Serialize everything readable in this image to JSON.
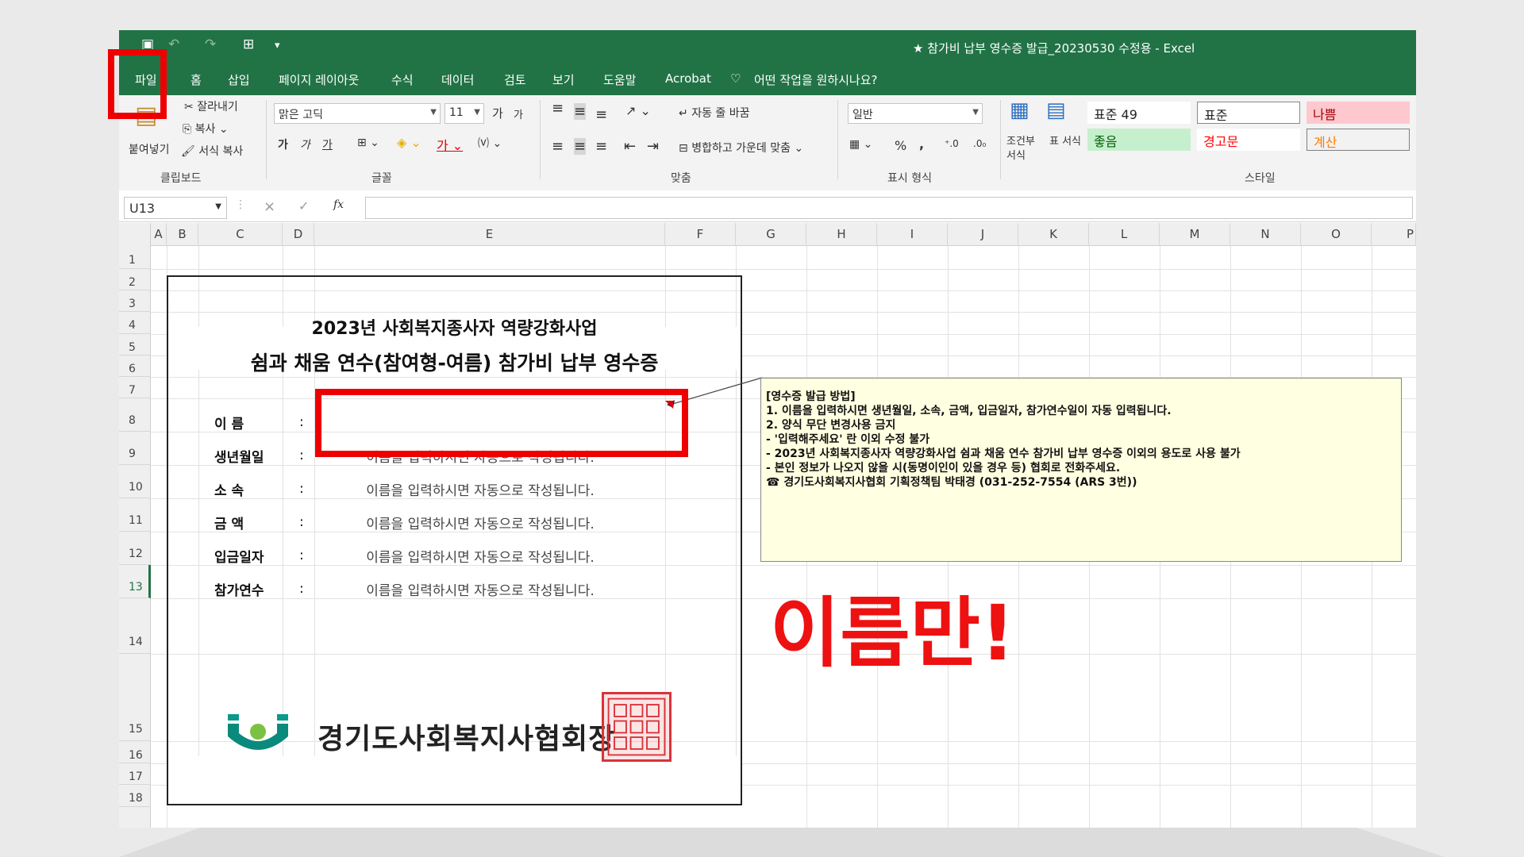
{
  "window": {
    "title": "★ 참가비 납부 영수증 발급_20230530 수정용 - Excel"
  },
  "tabs": [
    "파일",
    "홈",
    "삽입",
    "페이지 레이아웃",
    "수식",
    "데이터",
    "검토",
    "보기",
    "도움말",
    "Acrobat"
  ],
  "tell_me": "어떤 작업을 원하시나요?",
  "clipboard": {
    "paste": "붙여넣기",
    "cut": "잘라내기",
    "copy": "복사",
    "format_painter": "서식 복사",
    "group": "클립보드"
  },
  "font": {
    "name": "맑은 고딕",
    "size": "11",
    "grow": "가",
    "shrink": "가",
    "bold": "가",
    "italic": "가",
    "underline": "가",
    "group": "글꼴"
  },
  "alignment": {
    "wrap": "자동 줄 바꿈",
    "merge": "병합하고 가운데 맞춤",
    "group": "맞춤"
  },
  "number": {
    "format": "일반",
    "percent": "%",
    "comma": ",",
    "group": "표시 형식"
  },
  "styles": {
    "conditional": "조건부 서식",
    "table": "표 서식",
    "cells": [
      "표준 49",
      "표준",
      "나쁨",
      "좋음",
      "경고문",
      "계산"
    ],
    "group": "스타일"
  },
  "formula_bar": {
    "name_box": "U13",
    "cancel": "×",
    "enter": "✓",
    "fx": "fx",
    "value": ""
  },
  "columns": [
    "A",
    "B",
    "C",
    "D",
    "E",
    "F",
    "G",
    "H",
    "I",
    "J",
    "K",
    "L",
    "M",
    "N",
    "O",
    "P"
  ],
  "rows": [
    "1",
    "2",
    "3",
    "4",
    "5",
    "6",
    "7",
    "8",
    "9",
    "10",
    "11",
    "12",
    "13",
    "14",
    "15",
    "16",
    "17",
    "18"
  ],
  "receipt": {
    "title_line1": "2023년 사회복지종사자 역량강화사업",
    "title_line2": "쉼과 채움 연수(참여형-여름) 참가비 납부 영수증",
    "fields": [
      {
        "label": "이      름",
        "colon": ":",
        "value": ""
      },
      {
        "label": "생년월일",
        "colon": ":",
        "value": "이름을 입력하시면 자동으로 작성됩니다."
      },
      {
        "label": "소      속",
        "colon": ":",
        "value": "이름을 입력하시면 자동으로 작성됩니다."
      },
      {
        "label": "금      액",
        "colon": ":",
        "value": "이름을 입력하시면 자동으로 작성됩니다."
      },
      {
        "label": "입금일자",
        "colon": ":",
        "value": "이름을 입력하시면 자동으로 작성됩니다."
      },
      {
        "label": "참가연수",
        "colon": ":",
        "value": "이름을 입력하시면 자동으로 작성됩니다."
      }
    ],
    "org": "경기도사회복지사협회장"
  },
  "note": {
    "lines": [
      "[영수증 발급 방법]",
      "",
      "1. 이름을 입력하시면 생년월일, 소속, 금액, 입금일자, 참가연수일이 자동 입력됩니다.",
      "",
      "2. 양식 무단 변경사용 금지",
      " - '입력해주세요' 란 이외 수정 불가",
      " - 2023년 사회복지종사자 역량강화사업 쉼과 채움 연수 참가비 납부 영수증 이외의 용도로 사용 불가",
      " - 본인 정보가 나오지 않을 시(동명이인이 있을 경우 등) 협회로 전화주세요.",
      "",
      "☎ 경기도사회복지사협회 기획정책팀 박태경 (031-252-7554 (ARS 3번))"
    ]
  },
  "annotation": {
    "text": "이름만!"
  },
  "colors": {
    "excel_green": "#217346",
    "highlight_red": "#ee0000",
    "note_bg": "#ffffe1"
  }
}
